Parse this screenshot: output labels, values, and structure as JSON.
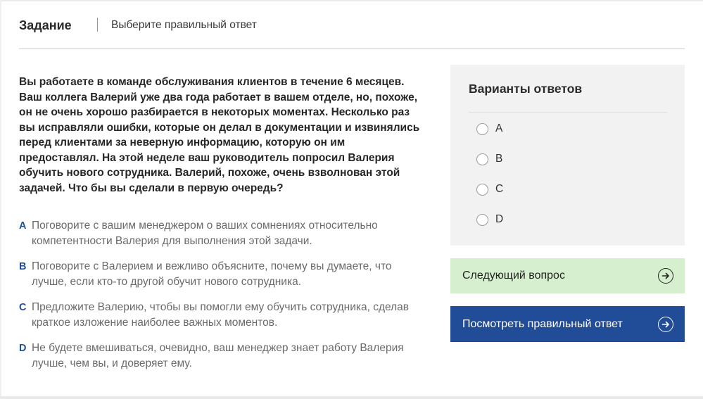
{
  "header": {
    "title": "Задание",
    "subtitle": "Выберите правильный ответ"
  },
  "question": {
    "lines": [
      "Вы работаете в команде обслуживания клиентов в течение 6 месяцев.",
      "Ваш коллега Валерий уже два года работает в вашем отделе, но, похоже,",
      "он не очень хорошо разбирается в некоторых моментах. Несколько раз",
      "вы исправляли ошибки, которые он делал в документации и извинялись",
      "перед клиентами за неверную информацию, которую он им",
      "предоставлял. На этой неделе ваш руководитель попросил Валерия",
      "обучить нового сотрудника. Валерий, похоже, очень взволнован этой",
      "задачей. Что бы вы сделали в первую очередь?"
    ]
  },
  "options": [
    {
      "letter": "A",
      "lines": [
        "Поговорите с вашим менеджером о ваших сомнениях относительно",
        "компетентности Валерия для выполнения этой задачи."
      ]
    },
    {
      "letter": "B",
      "lines": [
        "Поговорите с Валерием и вежливо объясните, почему вы думаете, что",
        "лучше, если кто-то другой обучит нового сотрудника."
      ]
    },
    {
      "letter": "C",
      "lines": [
        "Предложите Валерию, чтобы вы помогли ему обучить сотрудника, сделав",
        "краткое изложение наиболее важных моментов."
      ]
    },
    {
      "letter": "D",
      "lines": [
        "Не будете вмешиваться, очевидно, ваш менеджер знает работу Валерия",
        "лучше, чем вы, и доверяет ему."
      ]
    }
  ],
  "answers_panel": {
    "title": "Варианты ответов",
    "choices": [
      "A",
      "B",
      "C",
      "D"
    ]
  },
  "buttons": {
    "next_label": "Следующий вопрос",
    "show_answer_label": "Посмотреть правильный ответ"
  },
  "icons": {
    "next": "arrow-right-circle-icon",
    "show": "arrow-right-circle-icon"
  },
  "colors": {
    "accent_blue": "#214c98",
    "next_button_bg": "#d6f0cf",
    "panel_bg": "#f2f2f2"
  }
}
